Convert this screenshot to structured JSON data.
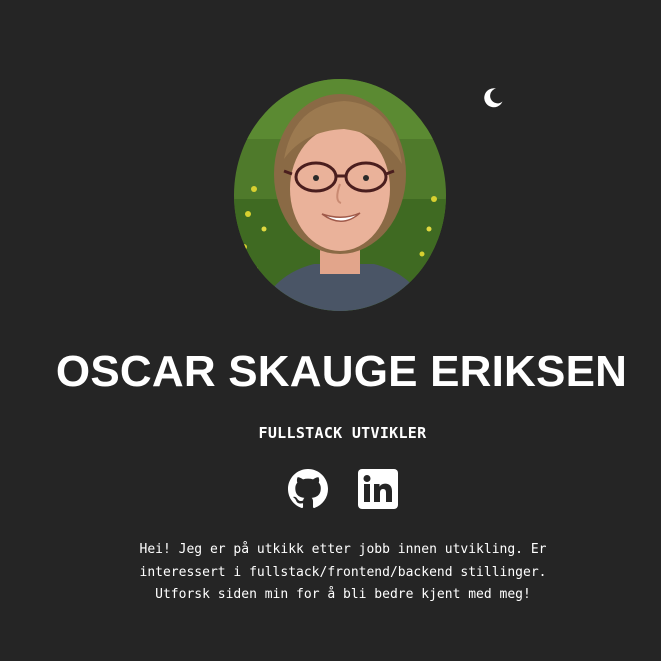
{
  "header": {
    "theme_toggle_icon": "crescent-moon-icon"
  },
  "profile": {
    "photo": "profile-photo",
    "name": "OSCAR SKAUGE ERIKSEN",
    "role": "FULLSTACK UTVIKLER"
  },
  "socials": [
    {
      "icon": "github-icon"
    },
    {
      "icon": "linkedin-icon"
    }
  ],
  "bio": {
    "text": "Hei! Jeg er på utkikk etter jobb innen utvikling. Er interessert i fullstack/frontend/backend stillinger. Utforsk siden min for å bli bedre kjent med meg!"
  },
  "colors": {
    "background": "#252525",
    "text": "#ffffff"
  }
}
